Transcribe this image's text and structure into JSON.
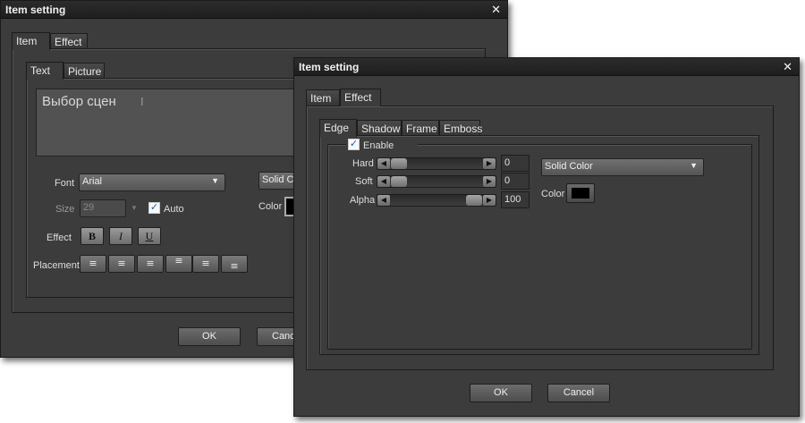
{
  "back": {
    "title": "Item setting",
    "tabs": [
      "Item",
      "Effect"
    ],
    "subtabs": [
      "Text",
      "Picture"
    ],
    "text_value": "Выбор сцен",
    "font_label": "Font",
    "font_value": "Arial",
    "size_label": "Size",
    "size_value": "29",
    "auto_label": "Auto",
    "effect_label": "Effect",
    "bold": "B",
    "italic": "I",
    "underline": "U",
    "placement_label": "Placement",
    "fill_value": "Solid Co",
    "color_label": "Color",
    "ok": "OK",
    "cancel": "Cance"
  },
  "front": {
    "title": "Item setting",
    "tabs": [
      "Item",
      "Effect"
    ],
    "subtabs": [
      "Edge",
      "Shadow",
      "Frame",
      "Emboss"
    ],
    "enable_label": "Enable",
    "sliders": [
      {
        "label": "Hard",
        "value": "0",
        "level": 0
      },
      {
        "label": "Soft",
        "value": "0",
        "level": 0
      },
      {
        "label": "Alpha",
        "value": "100",
        "level": 1.0
      }
    ],
    "fill_value": "Solid Color",
    "color_label": "Color",
    "ok": "OK",
    "cancel": "Cancel"
  },
  "colors": {
    "accent_check": "#1c5fb5",
    "swatch": "#000000"
  }
}
